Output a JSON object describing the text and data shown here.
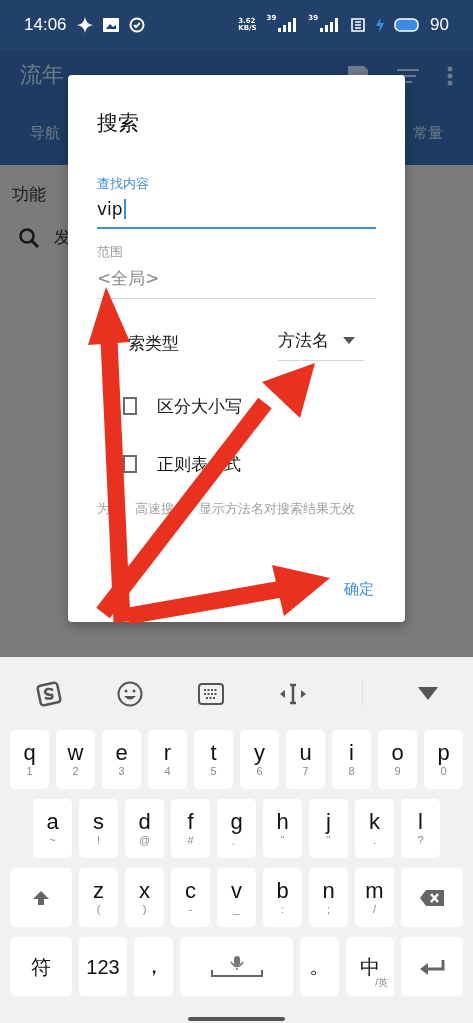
{
  "status_bar": {
    "time": "14:06",
    "net_speed": [
      "3.62",
      "KB/S"
    ],
    "signal_labels": [
      "39",
      "39"
    ],
    "battery": "90"
  },
  "app_bar": {
    "title": "流年",
    "tabs": [
      "导航",
      "常量"
    ]
  },
  "page": {
    "section": "功能",
    "item": "发"
  },
  "dialog": {
    "title": "搜索",
    "query": {
      "label": "查找内容",
      "value": "vip"
    },
    "scope": {
      "label": "范围",
      "placeholder": "<全局>"
    },
    "search_type": {
      "label": "索类型",
      "value": "方法名"
    },
    "options": [
      {
        "label_parts": [
          "区分大小写"
        ],
        "checked": false
      },
      {
        "label_parts": [
          "正则表",
          "式"
        ],
        "checked": false
      }
    ],
    "hint_parts": [
      "为",
      "高速搜",
      "显示方法名对搜索结果无效"
    ],
    "buttons": [
      "确定"
    ]
  },
  "keyboard": {
    "rows": [
      [
        {
          "kind": "letter",
          "main": "q",
          "sub": "1"
        },
        {
          "kind": "letter",
          "main": "w",
          "sub": "2"
        },
        {
          "kind": "letter",
          "main": "e",
          "sub": "3"
        },
        {
          "kind": "letter",
          "main": "r",
          "sub": "4"
        },
        {
          "kind": "letter",
          "main": "t",
          "sub": "5"
        },
        {
          "kind": "letter",
          "main": "y",
          "sub": "6"
        },
        {
          "kind": "letter",
          "main": "u",
          "sub": "7"
        },
        {
          "kind": "letter",
          "main": "i",
          "sub": "8"
        },
        {
          "kind": "letter",
          "main": "o",
          "sub": "9"
        },
        {
          "kind": "letter",
          "main": "p",
          "sub": "0"
        }
      ],
      [
        {
          "kind": "letter",
          "main": "a",
          "sub": "~"
        },
        {
          "kind": "letter",
          "main": "s",
          "sub": "!"
        },
        {
          "kind": "letter",
          "main": "d",
          "sub": "@"
        },
        {
          "kind": "letter",
          "main": "f",
          "sub": "#"
        },
        {
          "kind": "letter",
          "main": "g",
          "sub": "、"
        },
        {
          "kind": "letter",
          "main": "h",
          "sub": "“"
        },
        {
          "kind": "letter",
          "main": "j",
          "sub": "”"
        },
        {
          "kind": "letter",
          "main": "k",
          "sub": "."
        },
        {
          "kind": "letter",
          "main": "l",
          "sub": "?"
        }
      ],
      [
        {
          "kind": "shift"
        },
        {
          "kind": "letter",
          "main": "z",
          "sub": "("
        },
        {
          "kind": "letter",
          "main": "x",
          "sub": ")"
        },
        {
          "kind": "letter",
          "main": "c",
          "sub": "-"
        },
        {
          "kind": "letter",
          "main": "v",
          "sub": "_"
        },
        {
          "kind": "letter",
          "main": "b",
          "sub": ":"
        },
        {
          "kind": "letter",
          "main": "n",
          "sub": ";"
        },
        {
          "kind": "letter",
          "main": "m",
          "sub": "/"
        },
        {
          "kind": "backspace"
        }
      ]
    ],
    "bottom_bar": {
      "symbols": "符",
      "numbers": "123",
      "comma": "，",
      "period": "。",
      "language": "中",
      "language_alt": "/英"
    }
  }
}
